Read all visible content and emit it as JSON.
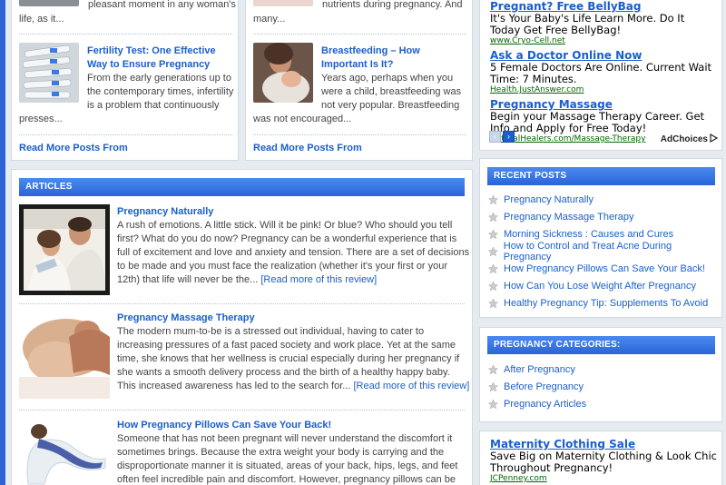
{
  "top_posts": {
    "left_top_text1": "pleasant moment in any woman's",
    "left_top_text2": "life, as it...",
    "right_top_text1": "nutrients during pregnancy. And",
    "right_top_text2": "many...",
    "left": {
      "title": "Fertility Test: One Effective Way to Ensure Pregnancy",
      "text": "From the early generations up to the contemporary times, infertility is a problem that continuously presses...",
      "readmore": "Read More Posts From"
    },
    "right": {
      "title": "Breastfeeding – How Important Is It?",
      "text": "Years ago, perhaps when you were a child, breastfeeding was not very popular. Breastfeeding was not encouraged...",
      "readmore": "Read More Posts From"
    }
  },
  "articles": {
    "header": "ARTICLES",
    "items": [
      {
        "title": "Pregnancy Naturally",
        "text": "A rush of emotions. A little stick. Will it be pink! Or blue? Who should you tell first? What do you do now? Pregnancy can be a wonderful experience that is full of excitement and love and anxiety and tension. There are a set of decisions to be made and you must face the realization (whether it's your first or your 12th) that life will never be the...",
        "more": "[Read more of this review]"
      },
      {
        "title": "Pregnancy Massage Therapy",
        "text": "The modern mum-to-be is a stressed out individual, having to cater to increasing pressures of a fast paced society and work place. Yet at the same time, she knows that her wellness is crucial especially during her pregnancy if she wants a smooth delivery process and the birth of a healthy happy baby. This increased awareness has led to the search for...",
        "more": "[Read more of this review]"
      },
      {
        "title": "How Pregnancy Pillows Can Save Your Back!",
        "text": "Someone that has not been pregnant will never understand the discomfort it sometimes brings. Because the extra weight your body is carrying and the disproportionate manner it is situated, areas of your back, hips, legs, and feet often feel incredible pain and discomfort. However, pregnancy pillows can be used to"
      }
    ]
  },
  "ads_top": {
    "items": [
      {
        "title": "Pregnant? Free BellyBag",
        "text": "It's Your Baby's Life Learn More. Do It Today Get Free BellyBag!",
        "url": "www.Cryo-Cell.net"
      },
      {
        "title": "Ask a Doctor Online Now",
        "text": "5 Female Doctors Are Online. Current Wait Time: 7 Minutes.",
        "url": "Health.JustAnswer.com"
      },
      {
        "title": "Pregnancy Massage",
        "text": "Begin your Massage Therapy Career. Get Info and Apply for Free Today!",
        "url": "NaturalHealers.com/Massage-Therapy"
      }
    ],
    "adchoices": "AdChoices"
  },
  "recent_posts": {
    "header": "RECENT POSTS",
    "items": [
      "Pregnancy Naturally",
      "Pregnancy Massage Therapy",
      "Morning Sickness : Causes and Cures",
      "How to Control and Treat Acne During Pregnancy",
      "How Pregnancy Pillows Can Save Your Back!",
      "How Can You Lose Weight After Pregnancy",
      "Healthy Pregnancy Tip: Supplements To Avoid"
    ]
  },
  "categories": {
    "header": "PREGNANCY CATEGORIES:",
    "items": [
      "After Pregnancy",
      "Before Pregnancy",
      "Pregnancy Articles"
    ]
  },
  "ads_bottom": {
    "title": "Maternity Clothing Sale",
    "text": "Save Big on Maternity Clothing & Look Chic Throughout Pregnancy!",
    "url": "JCPenney.com"
  },
  "colors": {
    "accent": "#2a64d8",
    "link": "#1a5fcb",
    "background": "#e6ebf1"
  }
}
